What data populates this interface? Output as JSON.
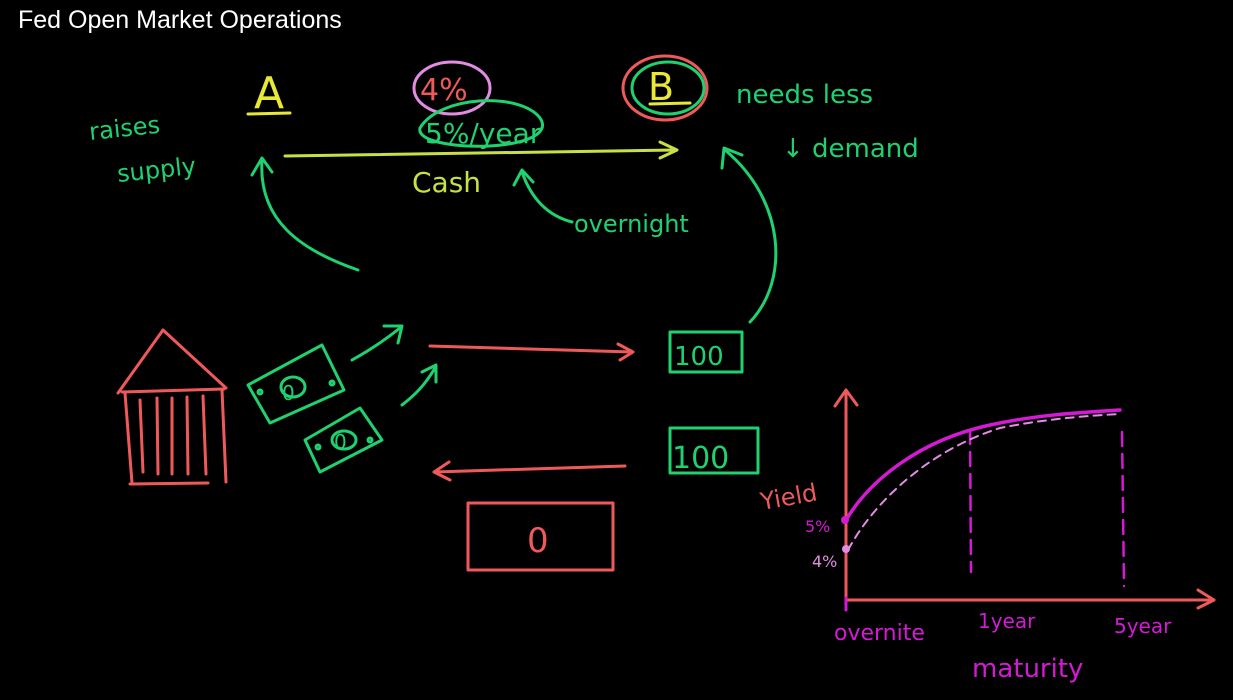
{
  "title": "Fed Open Market Operations",
  "colors": {
    "yellow": "#e8e836",
    "green": "#1fd16f",
    "pink_red": "#ee5a5a",
    "magenta": "#d41ad4",
    "lavender": "#e38ce3",
    "white": "#ffffff"
  },
  "board": {
    "bank_a": "A",
    "bank_b": "B",
    "rate_4": "4%",
    "rate_5": "5%/year",
    "cash": "Cash",
    "overnight": "overnight",
    "raises": "raises",
    "supply": "supply",
    "needs_less": "needs less",
    "down_demand": "↓ demand",
    "bill_100_top": "100",
    "bill_100_mid": "100",
    "fed_zero": "0",
    "bill_zero_a": "0",
    "bill_zero_b": "0"
  },
  "yield_graph": {
    "y_label": "Yield",
    "tick_5": "5%",
    "tick_4": "4%",
    "x_overnight": "overnite",
    "x_1year": "1year",
    "x_5year": "5year",
    "x_label": "maturity"
  }
}
